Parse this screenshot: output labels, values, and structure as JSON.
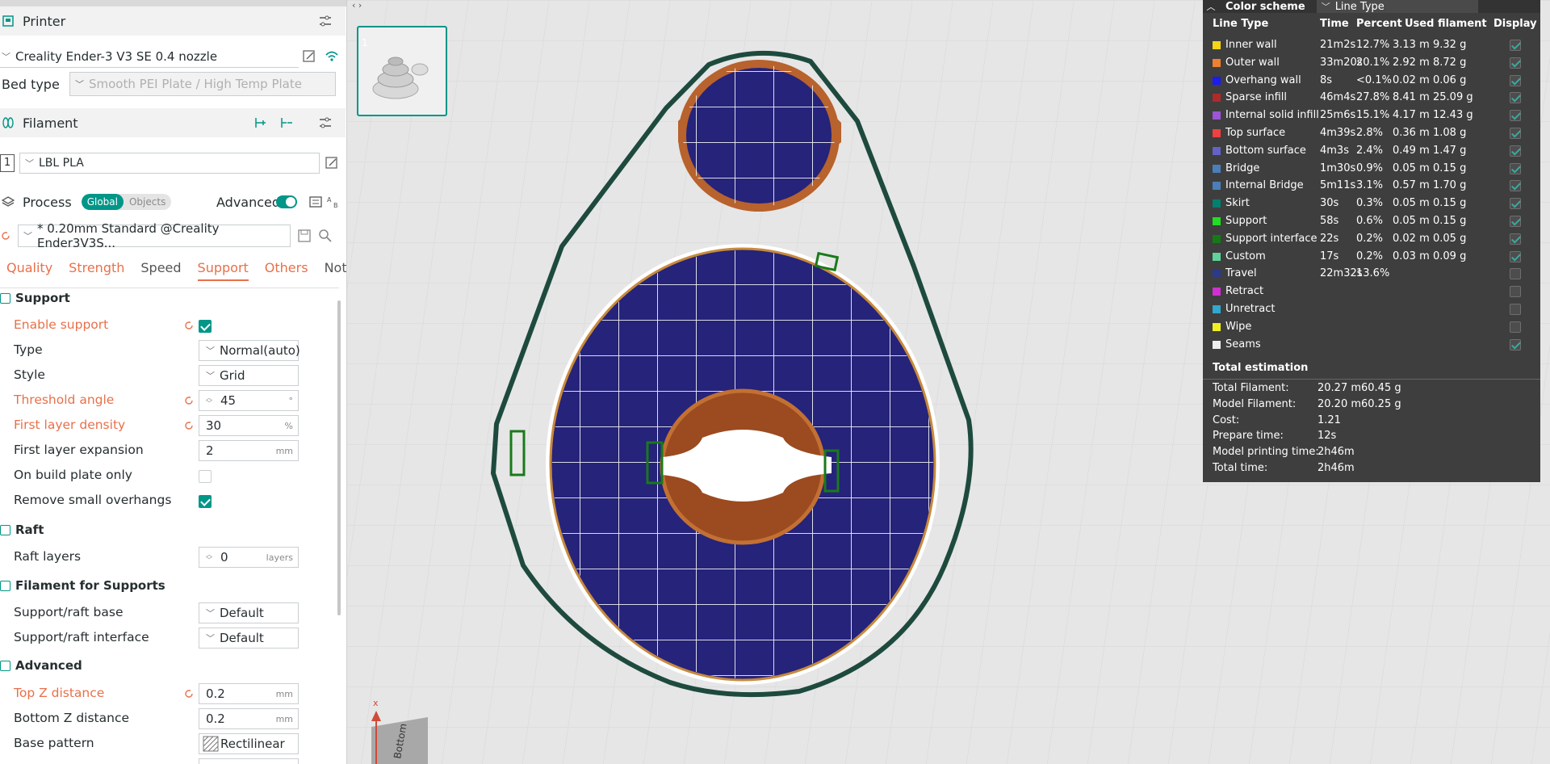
{
  "printer": {
    "title": "Printer",
    "name": "Creality Ender-3 V3 SE 0.4 nozzle",
    "bed_type_label": "Bed type",
    "bed_type_value": "Smooth PEI Plate / High Temp Plate"
  },
  "filament": {
    "title": "Filament",
    "slot": "1",
    "name": "LBL PLA"
  },
  "process": {
    "title": "Process",
    "scope_global": "Global",
    "scope_objects": "Objects",
    "advanced_label": "Advanced",
    "profile": "* 0.20mm Standard @Creality Ender3V3S..."
  },
  "tabs": [
    "Quality",
    "Strength",
    "Speed",
    "Support",
    "Others",
    "Notes"
  ],
  "support": {
    "group_title": "Support",
    "enable_label": "Enable support",
    "type_label": "Type",
    "type_value": "Normal(auto)",
    "style_label": "Style",
    "style_value": "Grid",
    "threshold_label": "Threshold angle",
    "threshold_value": "45",
    "threshold_unit": "°",
    "first_density_label": "First layer density",
    "first_density_value": "30",
    "first_density_unit": "%",
    "first_expansion_label": "First layer expansion",
    "first_expansion_value": "2",
    "first_expansion_unit": "mm",
    "build_plate_only_label": "On build plate only",
    "remove_small_label": "Remove small overhangs"
  },
  "raft": {
    "group_title": "Raft",
    "layers_label": "Raft layers",
    "layers_value": "0",
    "layers_unit": "layers"
  },
  "filament_supports": {
    "group_title": "Filament for Supports",
    "base_label": "Support/raft base",
    "base_value": "Default",
    "interface_label": "Support/raft interface",
    "interface_value": "Default"
  },
  "advanced": {
    "group_title": "Advanced",
    "top_z_label": "Top Z distance",
    "top_z_value": "0.2",
    "top_z_unit": "mm",
    "bottom_z_label": "Bottom Z distance",
    "bottom_z_value": "0.2",
    "bottom_z_unit": "mm",
    "base_pattern_label": "Base pattern",
    "base_pattern_value": "Rectilinear"
  },
  "viewport": {
    "plate_number": "1",
    "axis_x": "x",
    "view_label": "Bottom"
  },
  "legend": {
    "title": "Color scheme",
    "scheme_value": "Line Type",
    "headers": {
      "line_type": "Line Type",
      "time": "Time",
      "percent": "Percent",
      "used": "Used filament",
      "display": "Display"
    },
    "rows": [
      {
        "name": "Inner wall",
        "color": "#f5d515",
        "time": "21m2s",
        "percent": "12.7%",
        "m": "3.13 m",
        "g": "9.32 g",
        "display": true
      },
      {
        "name": "Outer wall",
        "color": "#f08030",
        "time": "33m20s",
        "percent": "20.1%",
        "m": "2.92 m",
        "g": "8.72 g",
        "display": true
      },
      {
        "name": "Overhang wall",
        "color": "#1c1cf0",
        "time": "8s",
        "percent": "<0.1%",
        "m": "0.02 m",
        "g": "0.06 g",
        "display": true
      },
      {
        "name": "Sparse infill",
        "color": "#b02a2a",
        "time": "46m4s",
        "percent": "27.8%",
        "m": "8.41 m",
        "g": "25.09 g",
        "display": true
      },
      {
        "name": "Internal solid infill",
        "color": "#9c55d6",
        "time": "25m6s",
        "percent": "15.1%",
        "m": "4.17 m",
        "g": "12.43 g",
        "display": true
      },
      {
        "name": "Top surface",
        "color": "#f04040",
        "time": "4m39s",
        "percent": "2.8%",
        "m": "0.36 m",
        "g": "1.08 g",
        "display": true
      },
      {
        "name": "Bottom surface",
        "color": "#6262c8",
        "time": "4m3s",
        "percent": "2.4%",
        "m": "0.49 m",
        "g": "1.47 g",
        "display": true
      },
      {
        "name": "Bridge",
        "color": "#4a7fb8",
        "time": "1m30s",
        "percent": "0.9%",
        "m": "0.05 m",
        "g": "0.15 g",
        "display": true
      },
      {
        "name": "Internal Bridge",
        "color": "#4a7fb8",
        "time": "5m11s",
        "percent": "3.1%",
        "m": "0.57 m",
        "g": "1.70 g",
        "display": true
      },
      {
        "name": "Skirt",
        "color": "#00806e",
        "time": "30s",
        "percent": "0.3%",
        "m": "0.05 m",
        "g": "0.15 g",
        "display": true
      },
      {
        "name": "Support",
        "color": "#22dd22",
        "time": "58s",
        "percent": "0.6%",
        "m": "0.05 m",
        "g": "0.15 g",
        "display": true
      },
      {
        "name": "Support interface",
        "color": "#157a15",
        "time": "22s",
        "percent": "0.2%",
        "m": "0.02 m",
        "g": "0.05 g",
        "display": true
      },
      {
        "name": "Custom",
        "color": "#5ed49a",
        "time": "17s",
        "percent": "0.2%",
        "m": "0.03 m",
        "g": "0.09 g",
        "display": true
      },
      {
        "name": "Travel",
        "color": "#2c3a8c",
        "time": "22m32s",
        "percent": "13.6%",
        "m": "",
        "g": "",
        "display": false
      },
      {
        "name": "Retract",
        "color": "#d030d0",
        "time": "",
        "percent": "",
        "m": "",
        "g": "",
        "display": false
      },
      {
        "name": "Unretract",
        "color": "#30a8d0",
        "time": "",
        "percent": "",
        "m": "",
        "g": "",
        "display": false
      },
      {
        "name": "Wipe",
        "color": "#f0f020",
        "time": "",
        "percent": "",
        "m": "",
        "g": "",
        "display": false
      },
      {
        "name": "Seams",
        "color": "#eeeeee",
        "time": "",
        "percent": "",
        "m": "",
        "g": "",
        "display": true
      }
    ],
    "total_title": "Total estimation",
    "totals": [
      {
        "label": "Total Filament:",
        "v1": "20.27 m",
        "v2": "60.45 g"
      },
      {
        "label": "Model Filament:",
        "v1": "20.20 m",
        "v2": "60.25 g"
      },
      {
        "label": "Cost:",
        "v1": "1.21",
        "v2": ""
      },
      {
        "label": "Prepare time:",
        "v1": "12s",
        "v2": ""
      },
      {
        "label": "Model printing time:",
        "v1": "2h46m",
        "v2": ""
      },
      {
        "label": "Total time:",
        "v1": "2h46m",
        "v2": ""
      }
    ]
  },
  "colors": {
    "accent": "#009688",
    "changed": "#e8704a",
    "legend_bg": "#3e3e3e"
  }
}
